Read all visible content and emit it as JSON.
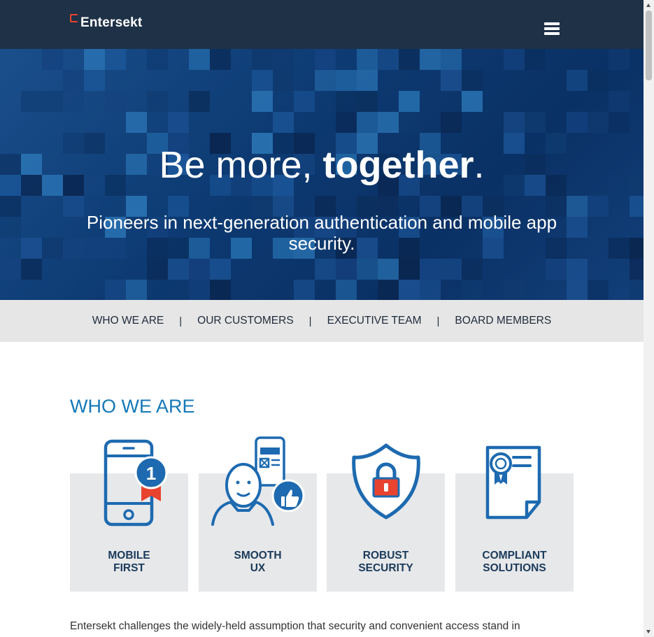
{
  "header": {
    "logo_text": "Entersekt",
    "menu_icon": "hamburger-menu-icon"
  },
  "hero": {
    "title_regular": "Be more, ",
    "title_bold": "together",
    "title_end": ".",
    "subtitle": "Pioneers in next-generation authentication and mobile app security."
  },
  "subnav": {
    "items": [
      "WHO WE ARE",
      "OUR CUSTOMERS",
      "EXECUTIVE TEAM",
      "BOARD MEMBERS"
    ],
    "separator": "|"
  },
  "who_we_are": {
    "title": "WHO WE ARE",
    "cards": [
      {
        "line1": "MOBILE",
        "line2": "FIRST",
        "icon": "mobile-first-icon"
      },
      {
        "line1": "SMOOTH",
        "line2": "UX",
        "icon": "smooth-ux-icon"
      },
      {
        "line1": "ROBUST",
        "line2": "SECURITY",
        "icon": "shield-lock-icon"
      },
      {
        "line1": "COMPLIANT",
        "line2": "SOLUTIONS",
        "icon": "certificate-icon"
      }
    ],
    "body": "Entersekt challenges the widely-held assumption that security and convenient access stand in"
  },
  "colors": {
    "header_bg": "#1e3147",
    "accent_blue": "#1579b8",
    "icon_blue": "#1d6ab0",
    "logo_red": "#e8432f",
    "card_bg": "#e7e8ea"
  }
}
